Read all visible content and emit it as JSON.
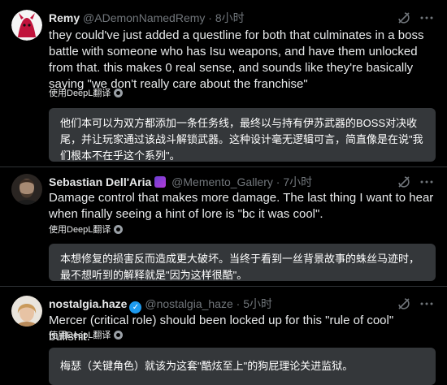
{
  "posts": [
    {
      "name": "Remy",
      "handle": "@ADemonNamedRemy",
      "time": "· 8小时",
      "text": "they could've just added a questline for both that culminates in a boss battle with someone who has Isu weapons, and have them unlocked from that. this makes 0 real sense, and sounds like they're basically saying \"we don't really care about the franchise\"",
      "translate_label": "使用DeepL翻译",
      "translation": "他们本可以为双方都添加一条任务线，最终以与持有伊苏武器的BOSS对决收尾，并让玩家通过该战斗解锁武器。这种设计毫无逻辑可言，简直像是在说\"我们根本不在乎这个系列\"。",
      "avatar_color": "#c0143c"
    },
    {
      "name": "Sebastian Dell'Aria",
      "handle": "@Memento_Gallery",
      "time": "· 7小时",
      "text": "Damage control that makes more damage. The last thing I want to hear when finally seeing a hint of lore is \"bc it was cool\".",
      "translate_label": "使用DeepL翻译",
      "translation": "本想修复的损害反而造成更大破坏。当终于看到一丝背景故事的蛛丝马迹时，最不想听到的解释就是\"因为这样很酷\"。",
      "avatar_color": "#6b5a4a"
    },
    {
      "name": "nostalgia.haze",
      "handle": "@nostalgia_haze",
      "time": "· 5小时",
      "text": "Mercer (critical role) should been locked up for this \"rule of cool\" bullshit.",
      "translate_label": "使用DeepL翻译",
      "translation": "梅瑟（关键角色）就该为这套\"酷炫至上\"的狗屁理论关进监狱。",
      "avatar_color": "#c9a27a"
    }
  ]
}
